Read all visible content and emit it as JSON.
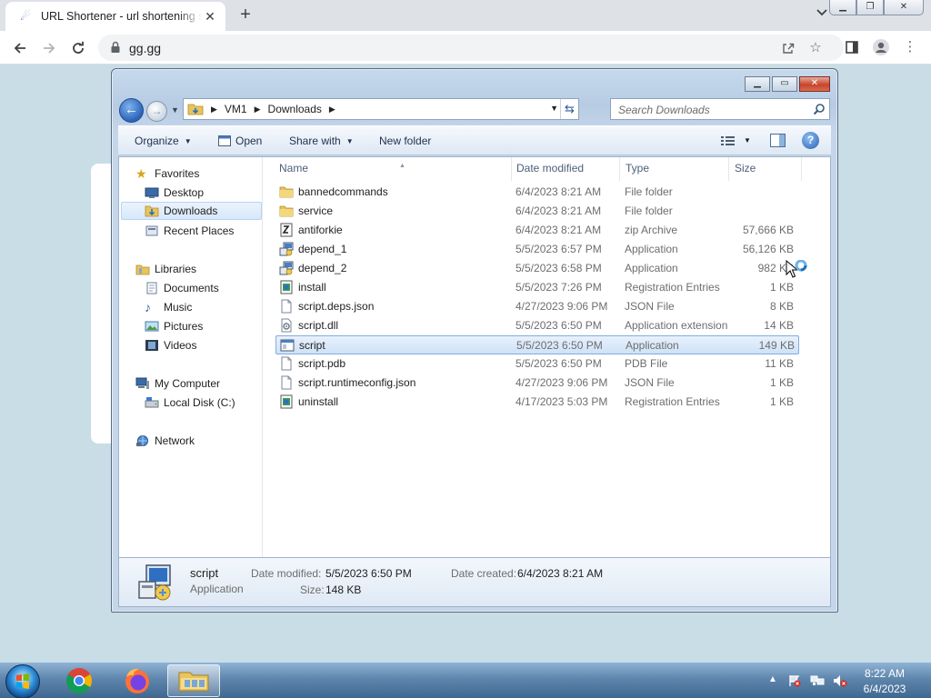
{
  "browser": {
    "tab_title": "URL Shortener - url shortening service",
    "url": "gg.gg",
    "new_tab_glyph": "+",
    "close_glyph": "✕"
  },
  "explorer": {
    "breadcrumb": [
      "VM1",
      "Downloads"
    ],
    "search_placeholder": "Search Downloads",
    "commands": {
      "organize": "Organize",
      "open": "Open",
      "share_with": "Share with",
      "new_folder": "New folder"
    },
    "nav": {
      "favorites": "Favorites",
      "desktop": "Desktop",
      "downloads": "Downloads",
      "recent_places": "Recent Places",
      "libraries": "Libraries",
      "documents": "Documents",
      "music": "Music",
      "pictures": "Pictures",
      "videos": "Videos",
      "my_computer": "My Computer",
      "local_disk": "Local Disk (C:)",
      "network": "Network"
    },
    "columns": {
      "name": "Name",
      "date_modified": "Date modified",
      "type": "Type",
      "size": "Size"
    },
    "files": [
      {
        "name": "bannedcommands",
        "date": "6/4/2023 8:21 AM",
        "type": "File folder",
        "size": "",
        "icon": "folder-icon"
      },
      {
        "name": "service",
        "date": "6/4/2023 8:21 AM",
        "type": "File folder",
        "size": "",
        "icon": "folder-icon"
      },
      {
        "name": "antiforkie",
        "date": "6/4/2023 8:21 AM",
        "type": "zip Archive",
        "size": "57,666 KB",
        "icon": "zip-icon"
      },
      {
        "name": "depend_1",
        "date": "5/5/2023 6:57 PM",
        "type": "Application",
        "size": "56,126 KB",
        "icon": "installer-icon"
      },
      {
        "name": "depend_2",
        "date": "5/5/2023 6:58 PM",
        "type": "Application",
        "size": "982 KB",
        "icon": "installer-icon"
      },
      {
        "name": "install",
        "date": "5/5/2023 7:26 PM",
        "type": "Registration Entries",
        "size": "1 KB",
        "icon": "registry-icon"
      },
      {
        "name": "script.deps.json",
        "date": "4/27/2023 9:06 PM",
        "type": "JSON File",
        "size": "8 KB",
        "icon": "document-icon"
      },
      {
        "name": "script.dll",
        "date": "5/5/2023 6:50 PM",
        "type": "Application extension",
        "size": "14 KB",
        "icon": "dll-icon"
      },
      {
        "name": "script",
        "date": "5/5/2023 6:50 PM",
        "type": "Application",
        "size": "149 KB",
        "icon": "application-icon"
      },
      {
        "name": "script.pdb",
        "date": "5/5/2023 6:50 PM",
        "type": "PDB File",
        "size": "11 KB",
        "icon": "document-icon"
      },
      {
        "name": "script.runtimeconfig.json",
        "date": "4/27/2023 9:06 PM",
        "type": "JSON File",
        "size": "1 KB",
        "icon": "document-icon"
      },
      {
        "name": "uninstall",
        "date": "4/17/2023 5:03 PM",
        "type": "Registration Entries",
        "size": "1 KB",
        "icon": "registry-icon"
      }
    ],
    "selected_index": 8,
    "details": {
      "name": "script",
      "type": "Application",
      "date_modified_label": "Date modified:",
      "date_modified": "5/5/2023 6:50 PM",
      "date_created_label": "Date created:",
      "date_created": "6/4/2023 8:21 AM",
      "size_label": "Size:",
      "size": "148 KB"
    }
  },
  "taskbar": {
    "time": "8:22 AM",
    "date": "6/4/2023",
    "pinned": [
      "chrome-icon",
      "firefox-icon",
      "explorer-icon"
    ]
  },
  "colors": {
    "desktop_bg": "#c8dde6",
    "selection": "#cfe2f8",
    "selection_border": "#84acdd",
    "taskbar": "#5f86ad"
  }
}
